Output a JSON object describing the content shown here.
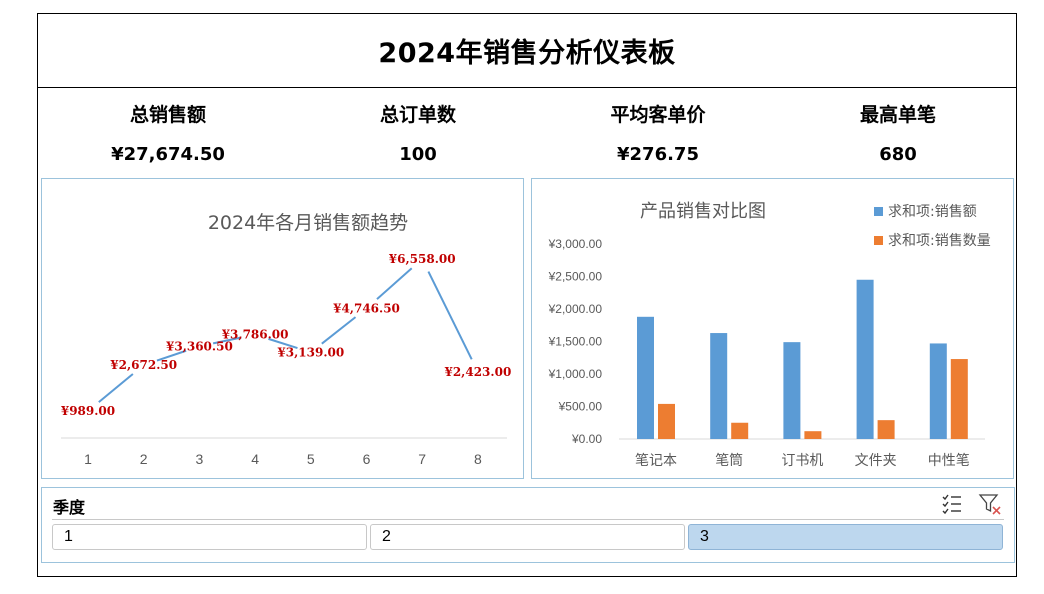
{
  "dashboard": {
    "title": "2024年销售分析仪表板",
    "kpis": [
      {
        "label": "总销售额",
        "value": "¥27,674.50"
      },
      {
        "label": "总订单数",
        "value": "100"
      },
      {
        "label": "平均客单价",
        "value": "¥276.75"
      },
      {
        "label": "最高单笔",
        "value": "680"
      }
    ]
  },
  "chart_data": [
    {
      "type": "line",
      "title": "2024年各月销售额趋势",
      "x": [
        "1",
        "2",
        "3",
        "4",
        "5",
        "6",
        "7",
        "8"
      ],
      "values": [
        989,
        2672.5,
        3360.5,
        3786,
        3139,
        4746.5,
        6558,
        2423
      ],
      "data_labels": [
        "¥989.00",
        "¥2,672.50",
        "¥3,360.50",
        "¥3,786.00",
        "¥3,139.00",
        "¥4,746.50",
        "¥6,558.00",
        "¥2,423.00"
      ],
      "color": "#5b9bd5",
      "label_color": "#c00000",
      "grid": false
    },
    {
      "type": "bar",
      "title": "产品销售对比图",
      "categories": [
        "笔记本",
        "笔筒",
        "订书机",
        "文件夹",
        "中性笔"
      ],
      "series": [
        {
          "name": "求和项:销售额",
          "values": [
            1880,
            1630,
            1490,
            2450,
            1470
          ],
          "color": "#5b9bd5"
        },
        {
          "name": "求和项:销售数量",
          "values": [
            540,
            250,
            120,
            290,
            1230
          ],
          "color": "#ed7d31"
        }
      ],
      "y_ticks": [
        "¥0.00",
        "¥500.00",
        "¥1,000.00",
        "¥1,500.00",
        "¥2,000.00",
        "¥2,500.00",
        "¥3,000.00"
      ],
      "ylim": [
        0,
        3000
      ],
      "legend": "top-right",
      "grid": false
    }
  ],
  "slicer": {
    "title": "季度",
    "items": [
      {
        "label": "1",
        "selected": false
      },
      {
        "label": "2",
        "selected": false
      },
      {
        "label": "3",
        "selected": true
      }
    ]
  }
}
